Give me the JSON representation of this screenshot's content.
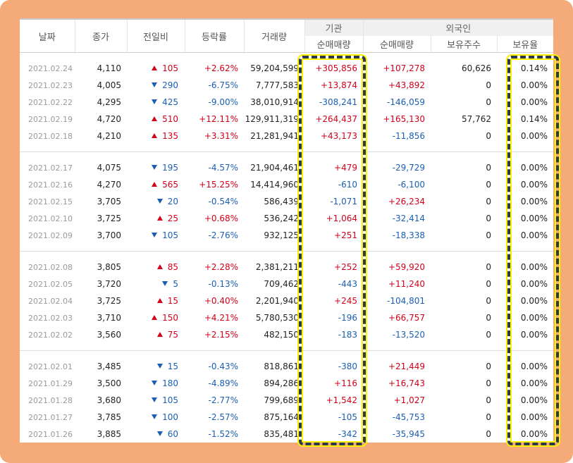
{
  "headers": {
    "date": "날짜",
    "close": "종가",
    "change": "전일비",
    "rate": "등락률",
    "volume": "거래량",
    "institution": "기관",
    "foreign": "외국인",
    "inst_net": "순매매량",
    "foreign_net": "순매매량",
    "foreign_shares": "보유주수",
    "foreign_ratio": "보유율"
  },
  "colors": {
    "up": "#d0021b",
    "down": "#1a5fb4",
    "frame": "#f4aa79",
    "highlight": "#fff200"
  },
  "groups": [
    [
      {
        "date": "2021.02.24",
        "close": "4,110",
        "dir": "up",
        "change": "105",
        "rate": "+2.62%",
        "volume": "59,204,599",
        "inst": "+305,856",
        "foreign": "+107,278",
        "shares": "60,626",
        "ratio": "0.14%"
      },
      {
        "date": "2021.02.23",
        "close": "4,005",
        "dir": "down",
        "change": "290",
        "rate": "-6.75%",
        "volume": "7,777,583",
        "inst": "+13,874",
        "foreign": "+43,892",
        "shares": "0",
        "ratio": "0.00%"
      },
      {
        "date": "2021.02.22",
        "close": "4,295",
        "dir": "down",
        "change": "425",
        "rate": "-9.00%",
        "volume": "38,010,914",
        "inst": "-308,241",
        "foreign": "-146,059",
        "shares": "0",
        "ratio": "0.00%"
      },
      {
        "date": "2021.02.19",
        "close": "4,720",
        "dir": "up",
        "change": "510",
        "rate": "+12.11%",
        "volume": "129,911,319",
        "inst": "+264,437",
        "foreign": "+165,130",
        "shares": "57,762",
        "ratio": "0.14%"
      },
      {
        "date": "2021.02.18",
        "close": "4,210",
        "dir": "up",
        "change": "135",
        "rate": "+3.31%",
        "volume": "21,281,941",
        "inst": "+43,173",
        "foreign": "-11,856",
        "shares": "0",
        "ratio": "0.00%"
      }
    ],
    [
      {
        "date": "2021.02.17",
        "close": "4,075",
        "dir": "down",
        "change": "195",
        "rate": "-4.57%",
        "volume": "21,904,461",
        "inst": "+479",
        "foreign": "-29,729",
        "shares": "0",
        "ratio": "0.00%"
      },
      {
        "date": "2021.02.16",
        "close": "4,270",
        "dir": "up",
        "change": "565",
        "rate": "+15.25%",
        "volume": "14,414,960",
        "inst": "-610",
        "foreign": "-6,100",
        "shares": "0",
        "ratio": "0.00%"
      },
      {
        "date": "2021.02.15",
        "close": "3,705",
        "dir": "down",
        "change": "20",
        "rate": "-0.54%",
        "volume": "586,439",
        "inst": "-1,071",
        "foreign": "+26,234",
        "shares": "0",
        "ratio": "0.00%"
      },
      {
        "date": "2021.02.10",
        "close": "3,725",
        "dir": "up",
        "change": "25",
        "rate": "+0.68%",
        "volume": "536,242",
        "inst": "+1,064",
        "foreign": "-32,414",
        "shares": "0",
        "ratio": "0.00%"
      },
      {
        "date": "2021.02.09",
        "close": "3,700",
        "dir": "down",
        "change": "105",
        "rate": "-2.76%",
        "volume": "932,125",
        "inst": "+251",
        "foreign": "-18,338",
        "shares": "0",
        "ratio": "0.00%"
      }
    ],
    [
      {
        "date": "2021.02.08",
        "close": "3,805",
        "dir": "up",
        "change": "85",
        "rate": "+2.28%",
        "volume": "2,381,211",
        "inst": "+252",
        "foreign": "+59,920",
        "shares": "0",
        "ratio": "0.00%"
      },
      {
        "date": "2021.02.05",
        "close": "3,720",
        "dir": "down",
        "change": "5",
        "rate": "-0.13%",
        "volume": "709,462",
        "inst": "-443",
        "foreign": "+11,240",
        "shares": "0",
        "ratio": "0.00%"
      },
      {
        "date": "2021.02.04",
        "close": "3,725",
        "dir": "up",
        "change": "15",
        "rate": "+0.40%",
        "volume": "2,201,940",
        "inst": "+245",
        "foreign": "-104,801",
        "shares": "0",
        "ratio": "0.00%"
      },
      {
        "date": "2021.02.03",
        "close": "3,710",
        "dir": "up",
        "change": "150",
        "rate": "+4.21%",
        "volume": "5,780,530",
        "inst": "-196",
        "foreign": "+66,757",
        "shares": "0",
        "ratio": "0.00%"
      },
      {
        "date": "2021.02.02",
        "close": "3,560",
        "dir": "up",
        "change": "75",
        "rate": "+2.15%",
        "volume": "482,150",
        "inst": "-183",
        "foreign": "-13,520",
        "shares": "0",
        "ratio": "0.00%"
      }
    ],
    [
      {
        "date": "2021.02.01",
        "close": "3,485",
        "dir": "down",
        "change": "15",
        "rate": "-0.43%",
        "volume": "818,861",
        "inst": "-380",
        "foreign": "+21,449",
        "shares": "0",
        "ratio": "0.00%"
      },
      {
        "date": "2021.01.29",
        "close": "3,500",
        "dir": "down",
        "change": "180",
        "rate": "-4.89%",
        "volume": "894,286",
        "inst": "+116",
        "foreign": "+16,743",
        "shares": "0",
        "ratio": "0.00%"
      },
      {
        "date": "2021.01.28",
        "close": "3,680",
        "dir": "down",
        "change": "105",
        "rate": "-2.77%",
        "volume": "799,689",
        "inst": "+1,542",
        "foreign": "+1,027",
        "shares": "0",
        "ratio": "0.00%"
      },
      {
        "date": "2021.01.27",
        "close": "3,785",
        "dir": "down",
        "change": "100",
        "rate": "-2.57%",
        "volume": "875,164",
        "inst": "-105",
        "foreign": "-45,753",
        "shares": "0",
        "ratio": "0.00%"
      },
      {
        "date": "2021.01.26",
        "close": "3,885",
        "dir": "down",
        "change": "60",
        "rate": "-1.52%",
        "volume": "835,481",
        "inst": "-342",
        "foreign": "-35,945",
        "shares": "0",
        "ratio": "0.00%"
      }
    ]
  ]
}
